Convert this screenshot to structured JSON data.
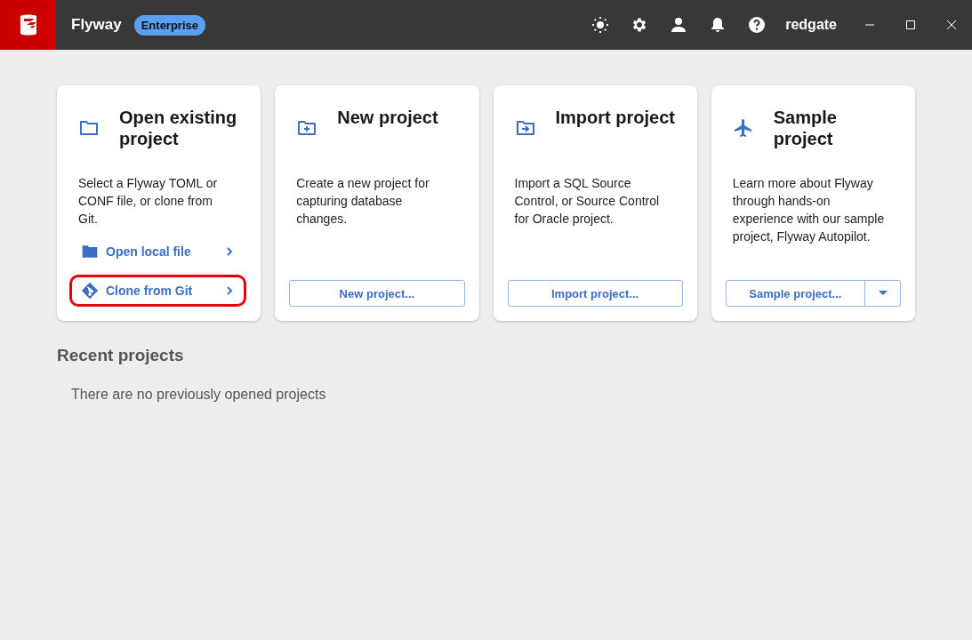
{
  "title_bar": {
    "app_name": "Flyway",
    "edition_badge": "Enterprise",
    "brand": "redgate"
  },
  "cards": [
    {
      "kind": "open",
      "title": "Open existing project",
      "description": "Select a Flyway TOML or CONF file, or clone from Git.",
      "links": [
        {
          "label": "Open local file",
          "kind": "folder",
          "highlighted": false
        },
        {
          "label": "Clone from Git",
          "kind": "git",
          "highlighted": true
        }
      ]
    },
    {
      "kind": "new",
      "title": "New project",
      "description": "Create a new project for capturing database changes.",
      "button": "New project...",
      "has_dropdown": false
    },
    {
      "kind": "import",
      "title": "Import project",
      "description": "Import a SQL Source Control, or Source Control for Oracle project.",
      "button": "Import project...",
      "has_dropdown": false
    },
    {
      "kind": "sample",
      "title": "Sample project",
      "description": "Learn more about Flyway through hands-on experience with our sample project, Flyway Autopilot.",
      "button": "Sample project...",
      "has_dropdown": true
    }
  ],
  "recent_projects": {
    "heading": "Recent projects",
    "empty_message": "There are no previously opened projects"
  }
}
